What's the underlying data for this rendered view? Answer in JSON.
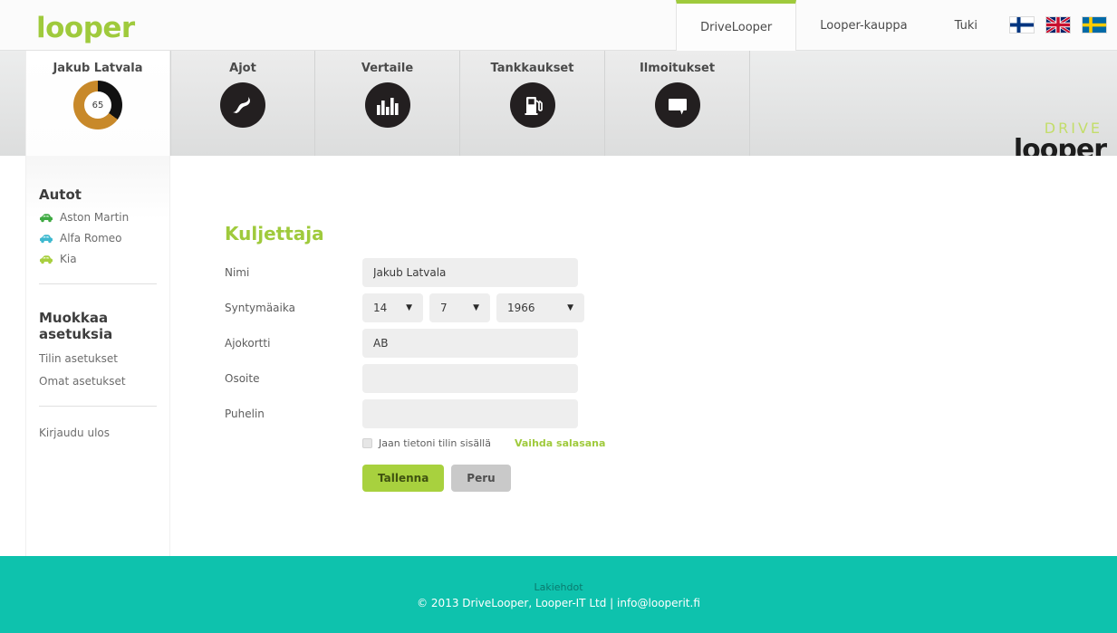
{
  "topbar": {
    "logo_text": "looper",
    "nav": [
      {
        "label": "DriveLooper",
        "active": true
      },
      {
        "label": "Looper-kauppa",
        "active": false
      },
      {
        "label": "Tuki",
        "active": false
      }
    ],
    "flags": [
      {
        "name": "finland-flag",
        "title": "Suomi"
      },
      {
        "name": "uk-flag",
        "title": "English"
      },
      {
        "name": "sweden-flag",
        "title": "Svenska"
      }
    ]
  },
  "user": {
    "name": "Jakub Latvala",
    "score": "65",
    "score_value": 65,
    "donut_color": "#c8892a",
    "donut_rest_color": "#111111"
  },
  "mainnav": [
    {
      "label": "Ajot",
      "icon": "road-icon"
    },
    {
      "label": "Vertaile",
      "icon": "bar-chart-icon"
    },
    {
      "label": "Tankkaukset",
      "icon": "fuel-pump-icon"
    },
    {
      "label": "Ilmoitukset",
      "icon": "speech-bubble-icon"
    }
  ],
  "drive_logo": {
    "drive": "DRIVE",
    "looper": "looper",
    "logout": "Kirjaudu ulos"
  },
  "sidebar": {
    "cars_heading": "Autot",
    "cars": [
      {
        "label": "Aston Martin",
        "color": "#3faa43"
      },
      {
        "label": "Alfa Romeo",
        "color": "#3fb9cf"
      },
      {
        "label": "Kia",
        "color": "#a8cf3f"
      }
    ],
    "settings_heading": "Muokkaa asetuksia",
    "settings_links": [
      {
        "label": "Tilin asetukset"
      },
      {
        "label": "Omat asetukset"
      }
    ],
    "logout_label": "Kirjaudu ulos"
  },
  "form": {
    "title": "Kuljettaja",
    "fields": {
      "nimi_label": "Nimi",
      "nimi_value": "Jakub Latvala",
      "syntymaaika_label": "Syntymäaika",
      "day": "14",
      "month": "7",
      "year": "1966",
      "ajokortti_label": "Ajokortti",
      "ajokortti_value": "AB",
      "osoite_label": "Osoite",
      "osoite_value": "",
      "puhelin_label": "Puhelin",
      "puhelin_value": ""
    },
    "share_label": "Jaan tietoni tilin sisällä",
    "share_checked": false,
    "password_link": "Vaihda salasana",
    "save_label": "Tallenna",
    "cancel_label": "Peru",
    "select_arrow": "▼"
  },
  "footer": {
    "terms": "Lakiehdot",
    "copyright": "© 2013 DriveLooper, Looper-IT Ltd | info@looperit.fi",
    "background": "#0ec2ad"
  }
}
